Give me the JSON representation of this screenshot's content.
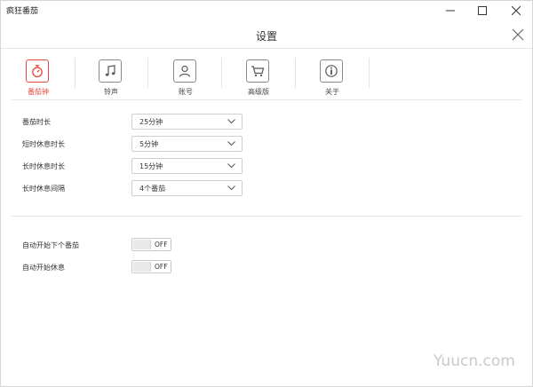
{
  "app": {
    "title": "疯狂番茄"
  },
  "dialog": {
    "title": "设置"
  },
  "tabs": [
    {
      "label": "番茄钟",
      "icon": "stopwatch-icon",
      "active": true
    },
    {
      "label": "铃声",
      "icon": "music-note-icon",
      "active": false
    },
    {
      "label": "账号",
      "icon": "user-icon",
      "active": false
    },
    {
      "label": "高级版",
      "icon": "cart-icon",
      "active": false
    },
    {
      "label": "关于",
      "icon": "info-icon",
      "active": false
    }
  ],
  "settings": [
    {
      "label": "番茄时长",
      "value": "25分钟"
    },
    {
      "label": "短时休息时长",
      "value": "5分钟"
    },
    {
      "label": "长时休息时长",
      "value": "15分钟"
    },
    {
      "label": "长时休息间隔",
      "value": "4个番茄"
    }
  ],
  "toggles": [
    {
      "label": "自动开始下个番茄",
      "state": "OFF"
    },
    {
      "label": "自动开始休息",
      "state": "OFF"
    }
  ],
  "colors": {
    "accent": "#e8463a",
    "border": "#cfcfcf"
  },
  "watermark": "Yuucn.com"
}
